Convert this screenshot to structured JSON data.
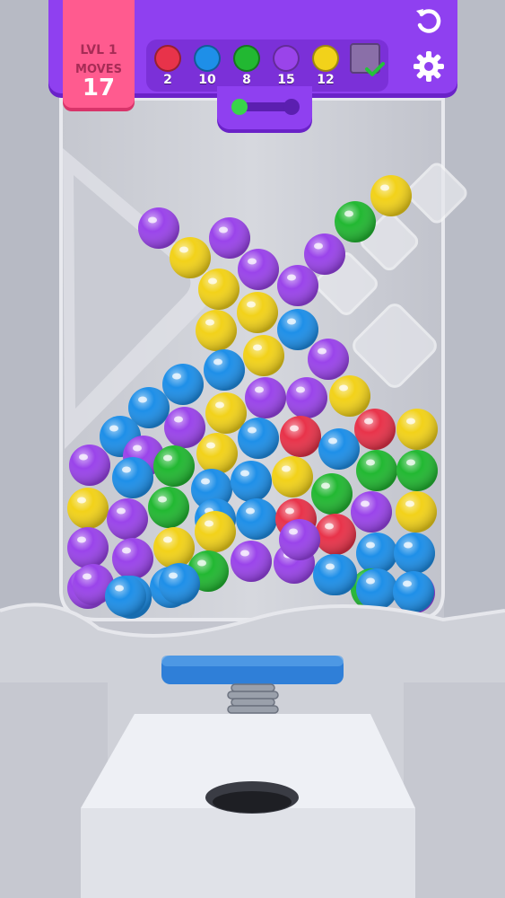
{
  "hud": {
    "level_label": "LVL 1",
    "moves_label": "MOVES",
    "moves_value": "17",
    "goals": [
      {
        "color": "#e8334a",
        "count": "2"
      },
      {
        "color": "#1e8fe8",
        "count": "10"
      },
      {
        "color": "#22b832",
        "count": "8"
      },
      {
        "color": "#9a44ea",
        "count": "15"
      },
      {
        "color": "#f2d21a",
        "count": "12"
      }
    ],
    "goal_complete_icon": "checkmark-icon",
    "progress": 0,
    "buttons": {
      "restart": "restart-icon",
      "settings": "gear-icon"
    }
  },
  "colors": {
    "red": "#e8334a",
    "blue": "#1e8fe8",
    "green": "#22b832",
    "purple": "#9a44ea",
    "yellow": "#f2d21a",
    "hud_purple": "#8f40f0",
    "level_pink": "#ff5b8f",
    "plunger_blue": "#2f7fd8"
  },
  "balls": [
    "yellow",
    "purple",
    "green",
    "purple",
    "yellow",
    "purple",
    "purple",
    "yellow",
    "purple",
    "yellow",
    "yellow",
    "blue",
    "yellow",
    "purple",
    "blue",
    "blue",
    "yellow",
    "purple",
    "purple",
    "yellow",
    "blue",
    "purple",
    "yellow",
    "red",
    "blue",
    "red",
    "yellow",
    "blue",
    "purple",
    "blue",
    "yellow",
    "purple",
    "blue",
    "green",
    "blue",
    "blue",
    "yellow",
    "green",
    "green",
    "green",
    "yellow",
    "purple",
    "green",
    "blue",
    "blue",
    "red",
    "red",
    "purple",
    "yellow",
    "purple",
    "purple",
    "yellow",
    "green",
    "purple",
    "purple",
    "blue",
    "blue",
    "blue",
    "purple",
    "blue",
    "green",
    "blue",
    "purple",
    "purple",
    "blue",
    "blue",
    "blue",
    "blue",
    "purple",
    "blue",
    "blue"
  ]
}
